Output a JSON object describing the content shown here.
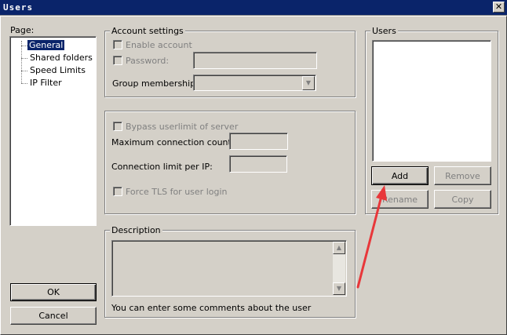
{
  "window": {
    "title": "Users",
    "close_glyph": "✕"
  },
  "page_panel": {
    "label": "Page:",
    "items": [
      "General",
      "Shared folders",
      "Speed Limits",
      "IP Filter"
    ]
  },
  "account_settings": {
    "title": "Account settings",
    "enable_account": "Enable account",
    "password": "Password:",
    "group_membership": "Group membership:"
  },
  "limits": {
    "bypass": "Bypass userlimit of server",
    "max_conn": "Maximum connection count:",
    "conn_per_ip": "Connection limit per IP:",
    "force_tls": "Force TLS for user login"
  },
  "description": {
    "title": "Description",
    "hint": "You can enter some comments about the user"
  },
  "users": {
    "title": "Users",
    "add": "Add",
    "remove": "Remove",
    "rename": "Rename",
    "copy": "Copy"
  },
  "footer": {
    "ok": "OK",
    "cancel": "Cancel"
  },
  "colors": {
    "annotation_arrow": "#e8373a",
    "selection": "#0a246a",
    "title_bar": "#0a246a"
  }
}
